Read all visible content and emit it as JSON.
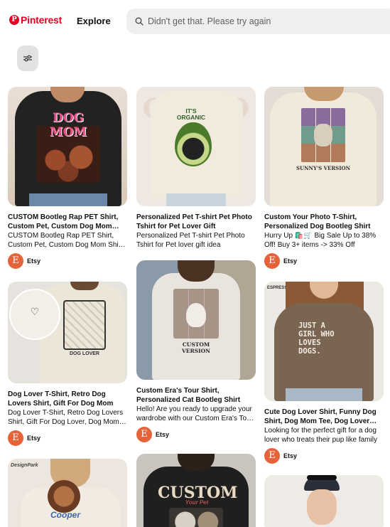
{
  "header": {
    "logo_text": "Pinterest",
    "explore_label": "Explore",
    "search_placeholder": "Didn't get that. Please try again",
    "brand_color": "#e60023"
  },
  "icons": {
    "search": "search-icon",
    "filter": "filter-sliders-icon"
  },
  "pins": [
    {
      "title": "CUSTOM Bootleg Rap PET Shirt, Custom Pet, Custom Dog Mom Shirt",
      "description": "CUSTOM Bootleg Rap PET Shirt, Custom Pet, Custom Dog Mom Shirt, Pet Portrait",
      "source": "Etsy",
      "avatar_letter": "E",
      "print_text": "DOG MOM"
    },
    {
      "title": "Personalized Pet T-shirt Pet Photo Tshirt for Pet Lover Gift",
      "description": "Personalized Pet T-shirt Pet Photo Tshirt for Pet lover gift idea",
      "source": "Etsy",
      "avatar_letter": "E",
      "print_text": "IT'S ORGANIC"
    },
    {
      "title": "Custom Your Photo T-Shirt, Personalized Dog Bootleg Shirt",
      "description": "Hurry Up 🛍️🛒 Big Sale Up to 38% Off! Buy 3+ items -> 33% Off",
      "source": "Etsy",
      "avatar_letter": "E",
      "print_text": "SUNNY'S VERSION"
    },
    {
      "title": "Dog Lover T-Shirt, Retro Dog Lovers Shirt, Gift For Dog Mom",
      "description": "Dog Lover T-Shirt, Retro Dog Lovers Shirt, Gift For Dog Lover, Dog Mom Gift",
      "source": "Etsy",
      "avatar_letter": "E",
      "print_text": "DOG LOVER"
    },
    {
      "title": "Custom Era's Tour Shirt, Personalized Cat Bootleg Shirt",
      "description": "Hello! Are you ready to upgrade your wardrobe with our Custom Era's Tour Shirt",
      "source": "Etsy",
      "avatar_letter": "E",
      "print_text": "CUSTOM VERSION"
    },
    {
      "title": "Cute Dog Lover Shirt, Funny Dog Shirt, Dog Mom Tee, Dog Lover Gift",
      "description": "Looking for the perfect gift for a dog lover who treats their pup like family",
      "source": "Etsy",
      "avatar_letter": "E",
      "print_text": "JUST A GIRL WHO LOVES DOGS."
    },
    {
      "print_text": "Cooper"
    },
    {
      "print_text": "CUSTOM"
    },
    {
      "print_text": ""
    }
  ]
}
